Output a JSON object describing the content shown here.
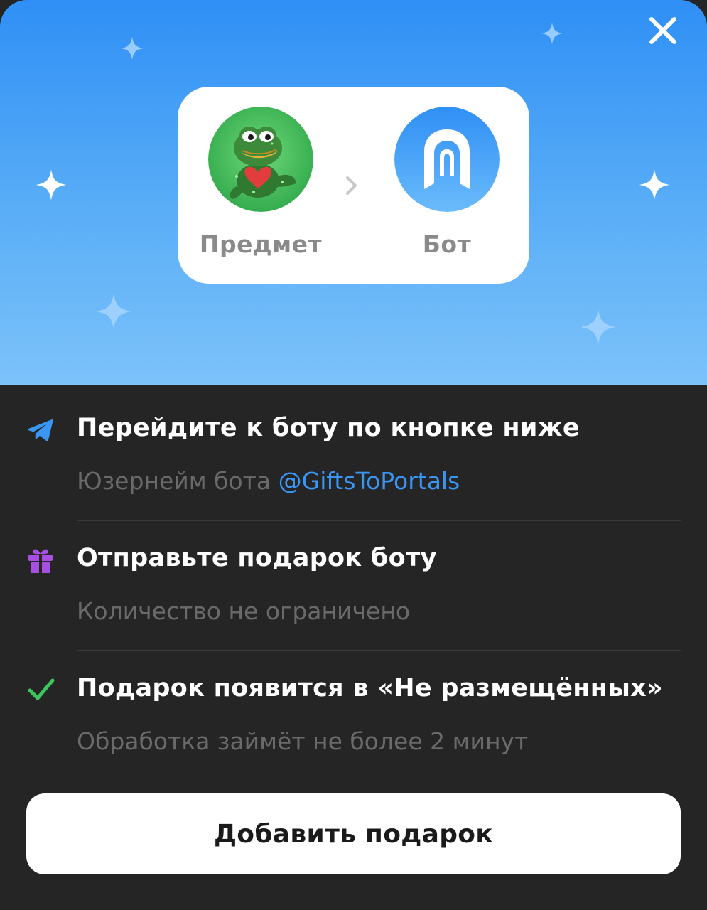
{
  "header": {
    "item_label": "Предмет",
    "bot_label": "Бот"
  },
  "steps": [
    {
      "title": "Перейдите к боту по кнопке ниже",
      "subtitle": "Юзернейм бота",
      "link": "@GiftsToPortals",
      "icon": "telegram-send-icon"
    },
    {
      "title": "Отправьте подарок боту",
      "subtitle": "Количество не ограничено",
      "icon": "gift-icon"
    },
    {
      "title": "Подарок появится в «Не размещённых»",
      "subtitle": "Обработка займёт не более 2 минут",
      "icon": "checkmark-icon"
    }
  ],
  "button": {
    "label": "Добавить подарок"
  },
  "colors": {
    "accent_blue": "#3b95f2",
    "gift_purple": "#a64fe0",
    "check_green": "#3dc65e",
    "background": "#252525"
  }
}
